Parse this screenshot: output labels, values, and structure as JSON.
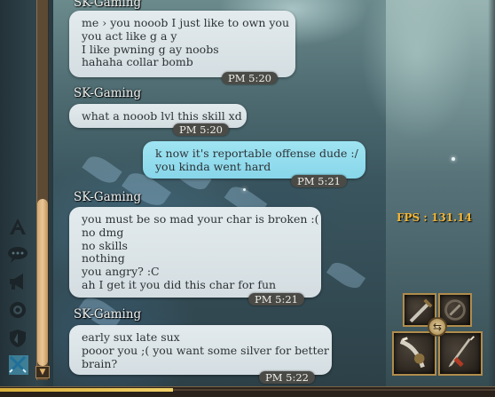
{
  "chat": {
    "messages": [
      {
        "sender": "SK-Gaming",
        "lines": [
          "me › you nooob I just like to own you",
          "you act like g a y",
          "I like pwning g ay noobs",
          "hahaha collar bomb"
        ],
        "time": "PM 5:20"
      },
      {
        "sender": "SK-Gaming",
        "lines": [
          "what a nooob lvl this skill xd"
        ],
        "time": "PM 5:20"
      },
      {
        "sender": "",
        "lines": [
          "k now it's reportable offense dude :/",
          "you kinda went hard"
        ],
        "time": "PM 5:21",
        "own": true
      },
      {
        "sender": "SK-Gaming",
        "lines": [
          "you must be so mad your char is broken :(",
          "no dmg",
          "no skills",
          "nothing",
          "you angry? :C",
          "ah I get it you did this char for fun"
        ],
        "time": "PM 5:21"
      },
      {
        "sender": "SK-Gaming",
        "lines": [
          "early sux late sux",
          "pooor you ;( you want some silver for better",
          "brain?"
        ],
        "time": "PM 5:22"
      }
    ]
  },
  "hud": {
    "fps_label": "FPS : 131.14",
    "xp_fraction": 0.35,
    "skills": [
      "weapon-slot-top-left",
      "weapon-slot-top-right",
      "weapon-slot-bottom-left",
      "weapon-slot-bottom-right"
    ],
    "swap_icon": "swap-arrows-icon"
  },
  "sidebar": {
    "icons": [
      "font-size-icon",
      "chat-bubbles-icon",
      "megaphone-icon",
      "guild-emblem-icon",
      "shield-icon",
      "crossed-swords-icon"
    ],
    "scroll_up_icon": "scroll-down-arrow-icon"
  },
  "colors": {
    "bubble_other": "#d9e2e6",
    "bubble_own": "#94ddef",
    "timestamp_bg": "#4a4a46",
    "fps": "#f3b636",
    "scroll_thumb": "#e0b987"
  }
}
